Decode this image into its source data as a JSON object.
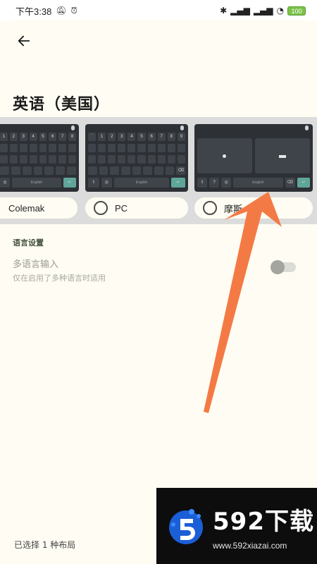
{
  "status_bar": {
    "time": "下午3:38",
    "battery": "100"
  },
  "page": {
    "title": "英语（美国）"
  },
  "layouts": [
    {
      "label": "Colemak",
      "selected": false
    },
    {
      "label": "PC",
      "selected": false
    },
    {
      "label": "摩斯",
      "selected": false
    }
  ],
  "keyboard": {
    "space_label": "English",
    "row1": [
      "1",
      "2",
      "3",
      "4",
      "5",
      "6",
      "7",
      "8",
      "9",
      "0"
    ]
  },
  "settings": {
    "section_title": "语言设置",
    "multilang": {
      "title": "多语言输入",
      "subtitle": "仅在启用了多种语言时适用",
      "enabled": false
    }
  },
  "footer": {
    "selected_count_text": "已选择 1 种布局"
  },
  "watermark": {
    "brand": "592下载",
    "url": "www.592xiazai.com"
  },
  "colors": {
    "background": "#fffdf3",
    "keyboard_bg": "#2d3035",
    "accent_enter": "#5fa59a",
    "arrow": "#f47a45"
  }
}
